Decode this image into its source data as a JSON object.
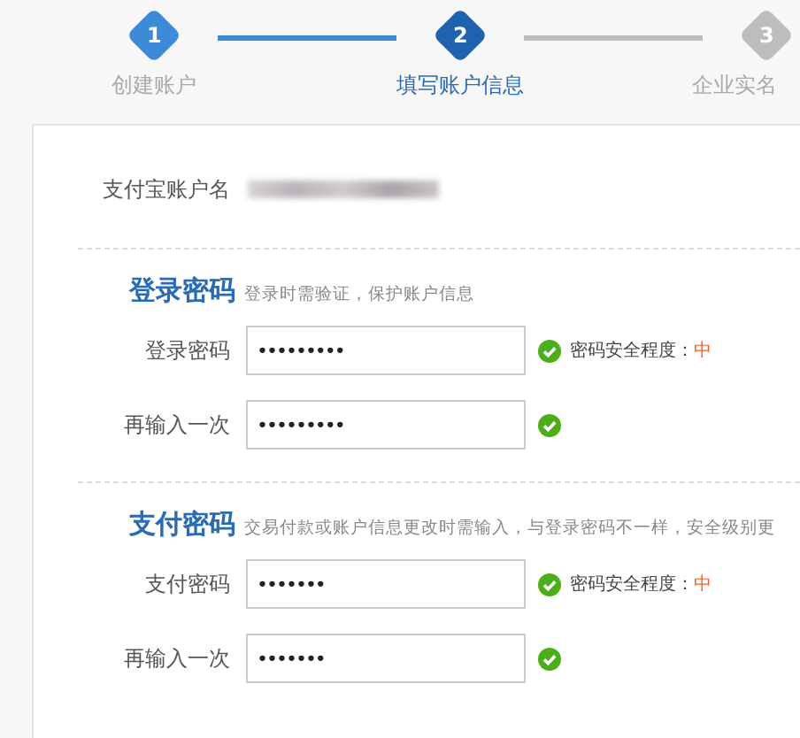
{
  "steps": [
    {
      "number": "1",
      "label": "创建账户",
      "completed": true,
      "selected": false
    },
    {
      "number": "2",
      "label": "填写账户信息",
      "completed": false,
      "selected": true
    },
    {
      "number": "3",
      "label": "企业实名",
      "completed": false,
      "selected": false
    }
  ],
  "account": {
    "label": "支付宝账户名"
  },
  "sections": [
    {
      "title": "登录密码",
      "description": "登录时需验证，保护账户信息",
      "fields": [
        {
          "label": "登录密码",
          "value": "•••••••••",
          "valid": true,
          "strength_label": "密码安全程度：",
          "strength": "中"
        },
        {
          "label": "再输入一次",
          "value": "•••••••••",
          "valid": true
        }
      ]
    },
    {
      "title": "支付密码",
      "description": "交易付款或账户信息更改时需输入，与登录密码不一样，安全级别更",
      "fields": [
        {
          "label": "支付密码",
          "value": "•••••••",
          "valid": true,
          "strength_label": "密码安全程度：",
          "strength": "中"
        },
        {
          "label": "再输入一次",
          "value": "•••••••",
          "valid": true
        }
      ]
    }
  ]
}
